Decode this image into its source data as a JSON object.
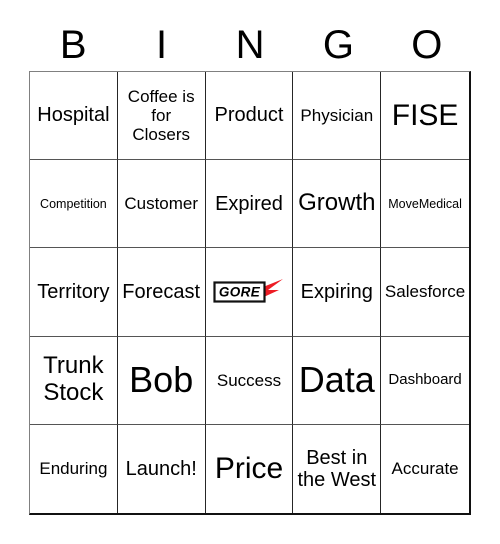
{
  "card": {
    "header_letters": [
      "B",
      "I",
      "N",
      "G",
      "O"
    ],
    "rows": [
      [
        {
          "text": "Hospital",
          "size": "lg"
        },
        {
          "text": "Coffee is for Closers",
          "size": "md"
        },
        {
          "text": "Product",
          "size": "lg"
        },
        {
          "text": "Physician",
          "size": "md"
        },
        {
          "text": "FISE",
          "size": "xxl"
        }
      ],
      [
        {
          "text": "Competition",
          "size": "xs"
        },
        {
          "text": "Customer",
          "size": "md"
        },
        {
          "text": "Expired",
          "size": "lg"
        },
        {
          "text": "Growth",
          "size": "xl"
        },
        {
          "text": "MoveMedical",
          "size": "xs"
        }
      ],
      [
        {
          "text": "Territory",
          "size": "lg"
        },
        {
          "text": "Forecast",
          "size": "lg"
        },
        {
          "text": "",
          "size": "md",
          "logo": "gore-logo"
        },
        {
          "text": "Expiring",
          "size": "lg"
        },
        {
          "text": "Salesforce",
          "size": "md"
        }
      ],
      [
        {
          "text": "Trunk Stock",
          "size": "xl"
        },
        {
          "text": "Bob",
          "size": "huge"
        },
        {
          "text": "Success",
          "size": "md"
        },
        {
          "text": "Data",
          "size": "huge"
        },
        {
          "text": "Dashboard",
          "size": "sm"
        }
      ],
      [
        {
          "text": "Enduring",
          "size": "md"
        },
        {
          "text": "Launch!",
          "size": "lg"
        },
        {
          "text": "Price",
          "size": "xxl"
        },
        {
          "text": "Best in the West",
          "size": "lg"
        },
        {
          "text": "Accurate",
          "size": "md"
        }
      ]
    ],
    "logo": {
      "gore": {
        "wordmark": "GORE",
        "box_fill": "#ffffff",
        "box_border": "#111111",
        "text_color": "#000000",
        "accent_color": "#ED1C24"
      }
    },
    "colors": {
      "background": "#ffffff",
      "text": "#000000",
      "grid_line": "#262626",
      "grid_outer": "#111111"
    }
  }
}
